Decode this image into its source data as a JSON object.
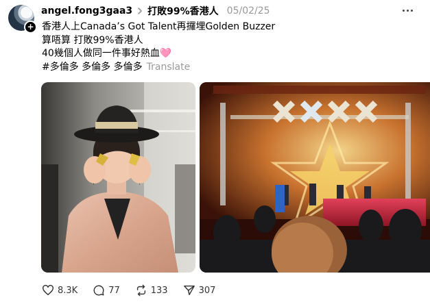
{
  "post": {
    "username": "angel.fong3gaa3",
    "topic": "打敗99%香港人",
    "date": "05/02/25",
    "lines": [
      "香港人上Canada’s Got Talent再攞埋Golden Buzzer",
      "算唔算 打敗99%香港人",
      "40幾個人做同一件事好熱血🩷",
      "#多倫多 多倫多 多倫多"
    ],
    "translate_label": "Translate"
  },
  "icons": {
    "avatar": "profile-avatar",
    "follow": "plus-icon",
    "separator": "chevron-right-icon",
    "menu": "more-horizontal-icon",
    "like": "heart-icon",
    "reply": "comment-icon",
    "repost": "repost-icon",
    "share": "send-icon"
  },
  "actions": {
    "likes": "8.3K",
    "replies": "77",
    "reposts": "133",
    "shares": "307"
  },
  "colors": {
    "text": "#000000",
    "secondary": "#999999",
    "icon": "#333333"
  }
}
